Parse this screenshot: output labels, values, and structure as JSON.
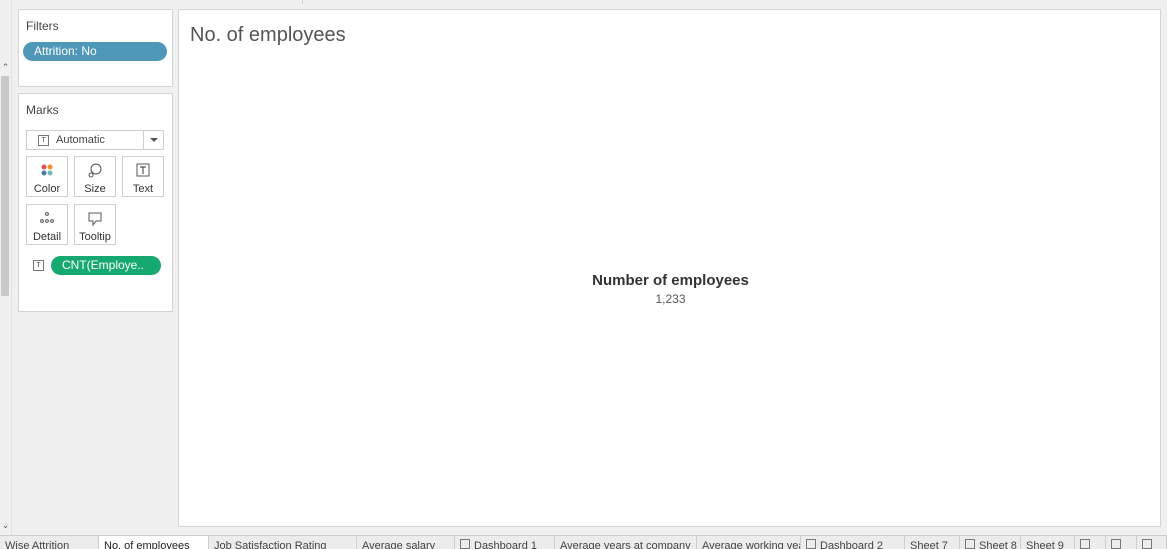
{
  "filters": {
    "title": "Filters",
    "items": [
      {
        "label": "Attrition: No"
      }
    ]
  },
  "marks": {
    "title": "Marks",
    "mark_type": "Automatic",
    "buttons": {
      "color": "Color",
      "size": "Size",
      "text": "Text",
      "detail": "Detail",
      "tooltip": "Tooltip"
    },
    "fields": [
      {
        "label": "CNT(Employe..",
        "color": "#16a96f"
      }
    ]
  },
  "view": {
    "title": "No. of employees",
    "kpi_label": "Number of employees",
    "kpi_value": "1,233"
  },
  "tabs": [
    {
      "label": "Wise Attrition"
    },
    {
      "label": "No. of employees",
      "active": true
    },
    {
      "label": "Job Satisfaction Rating"
    },
    {
      "label": "Average salary"
    },
    {
      "label": "Dashboard 1",
      "icon": "dashboard-icon"
    },
    {
      "label": "Average years at company"
    },
    {
      "label": "Average working years"
    },
    {
      "label": "Dashboard 2",
      "icon": "dashboard-icon"
    },
    {
      "label": "Sheet 7"
    },
    {
      "label": "Sheet 8",
      "icon": "story-icon"
    },
    {
      "label": "Sheet 9"
    }
  ],
  "colors": {
    "filter_pill": "#4f97b9",
    "measure_pill": "#16a96f"
  }
}
